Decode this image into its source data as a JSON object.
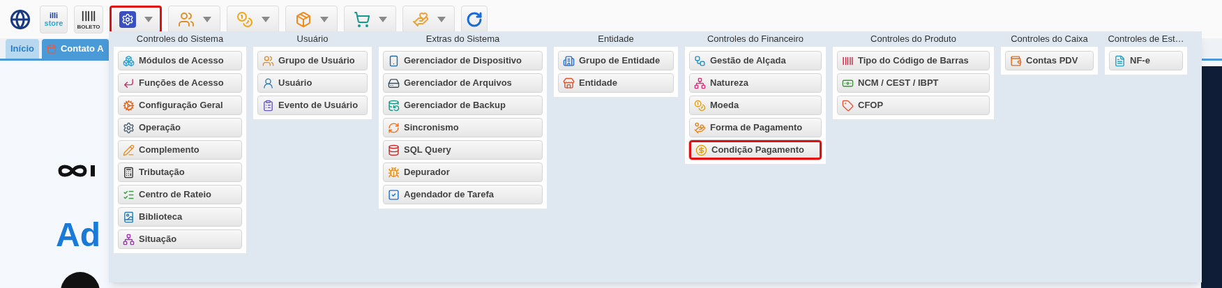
{
  "toolbar": [
    {
      "kind": "logo"
    },
    {
      "kind": "store",
      "lines": [
        "illi",
        "store"
      ]
    },
    {
      "kind": "boleto",
      "lines": [
        "BOLETO"
      ]
    },
    {
      "kind": "menu",
      "selected": true
    },
    {
      "kind": "menu",
      "selected": false
    },
    {
      "kind": "menu",
      "selected": false
    },
    {
      "kind": "menu",
      "selected": false
    },
    {
      "kind": "menu",
      "selected": false
    },
    {
      "kind": "menu",
      "selected": false
    },
    {
      "kind": "plain"
    }
  ],
  "tabs": [
    {
      "label": "Início",
      "selected": true,
      "kind": "home"
    },
    {
      "label": "Contato A",
      "selected": false,
      "kind": "calendar"
    }
  ],
  "page_behind": {
    "heading": "Ad"
  },
  "menu": {
    "columns": [
      {
        "title": "Controles do Sistema",
        "items": [
          {
            "label": "Módulos de Acesso",
            "highlighted": false
          },
          {
            "label": "Funções de Acesso",
            "highlighted": false
          },
          {
            "label": "Configuração Geral",
            "highlighted": false
          },
          {
            "label": "Operação",
            "highlighted": false
          },
          {
            "label": "Complemento",
            "highlighted": false
          },
          {
            "label": "Tributação",
            "highlighted": false
          },
          {
            "label": "Centro de Rateio",
            "highlighted": false
          },
          {
            "label": "Biblioteca",
            "highlighted": false
          },
          {
            "label": "Situação",
            "highlighted": false
          }
        ]
      },
      {
        "title": "Usuário",
        "items": [
          {
            "label": "Grupo de Usuário",
            "highlighted": false
          },
          {
            "label": "Usuário",
            "highlighted": false
          },
          {
            "label": "Evento de Usuário",
            "highlighted": false
          }
        ]
      },
      {
        "title": "Extras do Sistema",
        "items": [
          {
            "label": "Gerenciador de Dispositivo",
            "highlighted": false
          },
          {
            "label": "Gerenciador de Arquivos",
            "highlighted": false
          },
          {
            "label": "Gerenciador de Backup",
            "highlighted": false
          },
          {
            "label": "Sincronismo",
            "highlighted": false
          },
          {
            "label": "SQL Query",
            "highlighted": false
          },
          {
            "label": "Depurador",
            "highlighted": false
          },
          {
            "label": "Agendador de Tarefa",
            "highlighted": false
          }
        ]
      },
      {
        "title": "Entidade",
        "items": [
          {
            "label": "Grupo de Entidade",
            "highlighted": false
          },
          {
            "label": "Entidade",
            "highlighted": false
          }
        ]
      },
      {
        "title": "Controles do Financeiro",
        "items": [
          {
            "label": "Gestão de Alçada",
            "highlighted": false
          },
          {
            "label": "Natureza",
            "highlighted": false
          },
          {
            "label": "Moeda",
            "highlighted": false
          },
          {
            "label": "Forma de Pagamento",
            "highlighted": false
          },
          {
            "label": "Condição Pagamento",
            "highlighted": true
          }
        ]
      },
      {
        "title": "Controles do Produto",
        "items": [
          {
            "label": "Tipo do Código de Barras",
            "highlighted": false
          },
          {
            "label": "NCM / CEST / IBPT",
            "highlighted": false
          },
          {
            "label": "CFOP",
            "highlighted": false
          }
        ]
      },
      {
        "title": "Controles do Caixa",
        "items": [
          {
            "label": "Contas PDV",
            "highlighted": false
          }
        ]
      },
      {
        "title": "Controles de Est…",
        "items": [
          {
            "label": "NF-e",
            "highlighted": false
          }
        ]
      }
    ]
  }
}
